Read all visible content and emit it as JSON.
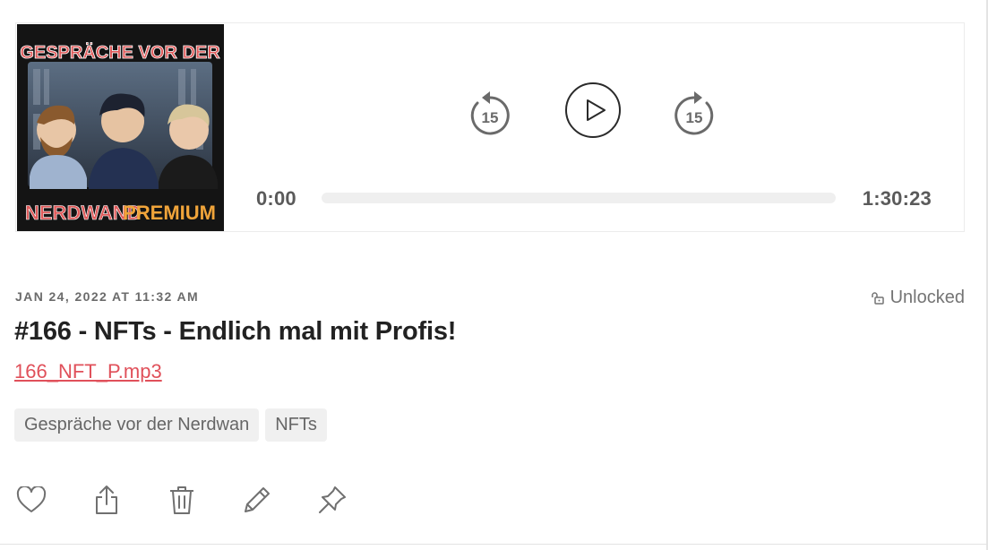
{
  "player": {
    "cover_title_top": "GESPRÄCHE VOR DER",
    "cover_title_bottom_left": "NERDWAND",
    "cover_title_bottom_right": "PREMIUM",
    "rewind_seconds": "15",
    "forward_seconds": "15",
    "current_time": "0:00",
    "total_time": "1:30:23",
    "progress_fraction": 0
  },
  "post": {
    "date": "JAN 24, 2022 AT 11:32 AM",
    "access_label": "Unlocked",
    "title": "#166 - NFTs - Endlich mal mit Profis!",
    "file_name": "166_NFT_P.mp3",
    "tags": [
      "Gespräche vor der Nerdwan",
      "NFTs"
    ]
  },
  "actions": {
    "icons": [
      "heart-icon",
      "share-icon",
      "trash-icon",
      "pencil-icon",
      "pin-icon"
    ]
  },
  "colors": {
    "link": "#e0505a",
    "tag_bg": "#f0f0f0",
    "icon": "#707070"
  }
}
